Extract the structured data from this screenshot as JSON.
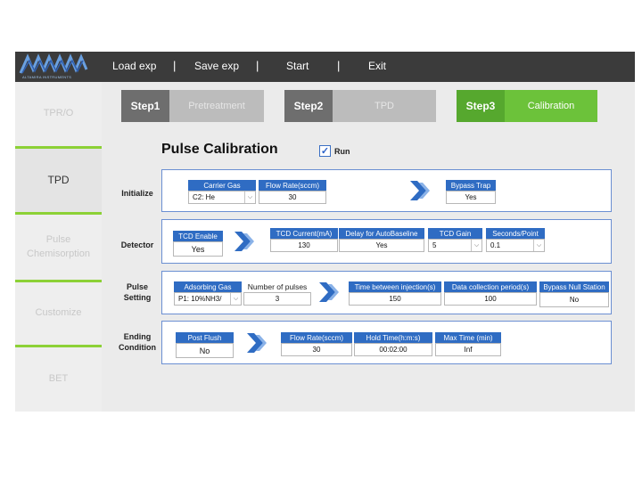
{
  "logo": {
    "brand_text": "ALTAMIRA INSTRUMENTS"
  },
  "menu": {
    "items": [
      "Load exp",
      "Save exp",
      "Start",
      "Exit"
    ],
    "separator": "|"
  },
  "sidebar": {
    "items": [
      {
        "label": "TPR/O",
        "active": false
      },
      {
        "label": "TPD",
        "active": true
      },
      {
        "label": "Pulse Chemisorption",
        "active": false
      },
      {
        "label": "Customize",
        "active": false
      },
      {
        "label": "BET",
        "active": false
      }
    ]
  },
  "steps": [
    {
      "num": "Step1",
      "name": "Pretreatment",
      "state": "inactive"
    },
    {
      "num": "Step2",
      "name": "TPD",
      "state": "inactive"
    },
    {
      "num": "Step3",
      "name": "Calibration",
      "state": "active"
    }
  ],
  "page": {
    "title": "Pulse Calibration",
    "run_label": "Run",
    "run_checked": true,
    "check_mark": "✓",
    "dropdown_glyph": "⌵"
  },
  "initialize": {
    "label": "Initialize",
    "carrier_gas_header": "Carrier Gas",
    "carrier_gas_value": "C2: He",
    "flow_rate_header": "Flow Rate(sccm)",
    "flow_rate_value": "30",
    "bypass_trap_header": "Bypass Trap",
    "bypass_trap_value": "Yes"
  },
  "detector": {
    "label": "Detector",
    "tcd_enable_header": "TCD Enable",
    "tcd_enable_value": "Yes",
    "tcd_current_header": "TCD Current(mA)",
    "tcd_current_value": "130",
    "delay_header": "Delay for AutoBaseline",
    "delay_value": "Yes",
    "tcd_gain_header": "TCD Gain",
    "tcd_gain_value": "5",
    "seconds_header": "Seconds/Point",
    "seconds_value": "0.1"
  },
  "pulse": {
    "label_line1": "Pulse",
    "label_line2": "Setting",
    "adsorbing_gas_header": "Adsorbing Gas",
    "adsorbing_gas_value": "P1: 10%NH3/",
    "num_pulses_header": "Number of pulses",
    "num_pulses_value": "3",
    "time_between_header": "Time between injection(s)",
    "time_between_value": "150",
    "data_collection_header": "Data collection period(s)",
    "data_collection_value": "100",
    "bypass_null_header": "Bypass Null Station",
    "bypass_null_value": "No"
  },
  "ending": {
    "label_line1": "Ending",
    "label_line2": "Condition",
    "post_flush_header": "Post Flush",
    "post_flush_value": "No",
    "flow_rate_header": "Flow Rate(sccm)",
    "flow_rate_value": "30",
    "hold_time_header": "Hold Time(h:m:s)",
    "hold_time_value": "00:02:00",
    "max_time_header": "Max Time (min)",
    "max_time_value": "Inf"
  },
  "colors": {
    "accent_blue": "#2f6cc3",
    "active_green": "#6cc23a",
    "topbar": "#3b3b3b"
  }
}
